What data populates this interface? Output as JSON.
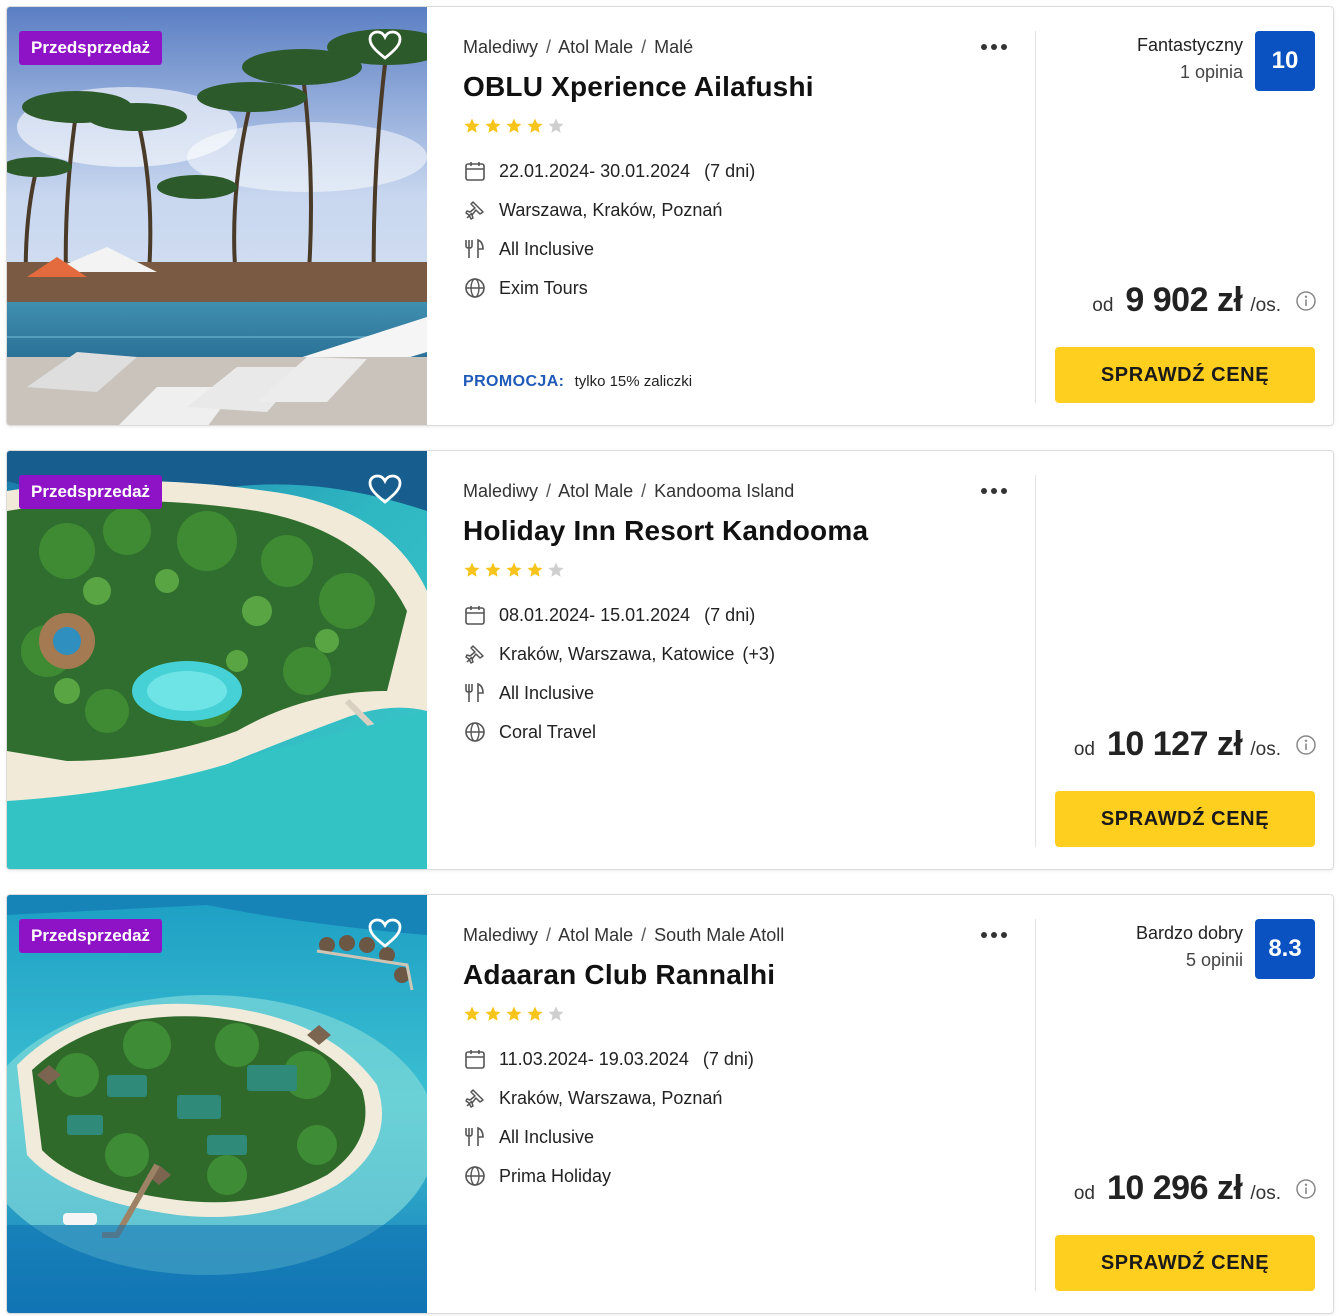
{
  "offers": [
    {
      "badge": "Przedsprzedaż",
      "breadcrumb": [
        "Malediwy",
        "Atol Male",
        "Malé"
      ],
      "separator": "/",
      "title": "OBLU Xperience Ailafushi",
      "stars": 4,
      "max_stars": 5,
      "dates": "22.01.2024- 30.01.2024",
      "nights": "(7 dni)",
      "departure": "Warszawa, Kraków, Poznań",
      "departure_extra": "",
      "board": "All Inclusive",
      "operator": "Exim Tours",
      "promo_label": "PROMOCJA:",
      "promo_text": "tylko 15% zaliczki",
      "rating_word": "Fantastyczny",
      "rating_count": "1 opinia",
      "rating_score": "10",
      "price_prefix": "od",
      "price": "9 902 zł",
      "price_suffix": "/os.",
      "cta": "SPRAWDŹ CENĘ"
    },
    {
      "badge": "Przedsprzedaż",
      "breadcrumb": [
        "Malediwy",
        "Atol Male",
        "Kandooma Island"
      ],
      "separator": "/",
      "title": "Holiday Inn Resort Kandooma",
      "stars": 4,
      "max_stars": 5,
      "dates": "08.01.2024- 15.01.2024",
      "nights": "(7 dni)",
      "departure": "Kraków, Warszawa, Katowice",
      "departure_extra": "(+3)",
      "board": "All Inclusive",
      "operator": "Coral Travel",
      "promo_label": "",
      "promo_text": "",
      "rating_word": "",
      "rating_count": "",
      "rating_score": "",
      "price_prefix": "od",
      "price": "10 127 zł",
      "price_suffix": "/os.",
      "cta": "SPRAWDŹ CENĘ"
    },
    {
      "badge": "Przedsprzedaż",
      "breadcrumb": [
        "Malediwy",
        "Atol Male",
        "South Male Atoll"
      ],
      "separator": "/",
      "title": "Adaaran Club Rannalhi",
      "stars": 4,
      "max_stars": 5,
      "dates": "11.03.2024- 19.03.2024",
      "nights": "(7 dni)",
      "departure": "Kraków, Warszawa, Poznań",
      "departure_extra": "",
      "board": "All Inclusive",
      "operator": "Prima Holiday",
      "promo_label": "",
      "promo_text": "",
      "rating_word": "Bardzo dobry",
      "rating_count": "5 opinii",
      "rating_score": "8.3",
      "price_prefix": "od",
      "price": "10 296 zł",
      "price_suffix": "/os.",
      "cta": "SPRAWDŹ CENĘ"
    }
  ],
  "icons": {
    "favorite": "heart-icon",
    "menu": "more-dots-icon",
    "star": "star-icon",
    "dates": "calendar-icon",
    "departure": "plane-icon",
    "board": "fork-knife-icon",
    "operator": "globe-icon",
    "price_info": "info-icon"
  },
  "colors": {
    "badge": "#8e13c7",
    "score": "#0a52c2",
    "cta": "#ffcf1f",
    "star_on": "#f7c41b",
    "star_off": "#cfcfcf",
    "promo": "#1f5ab8"
  }
}
